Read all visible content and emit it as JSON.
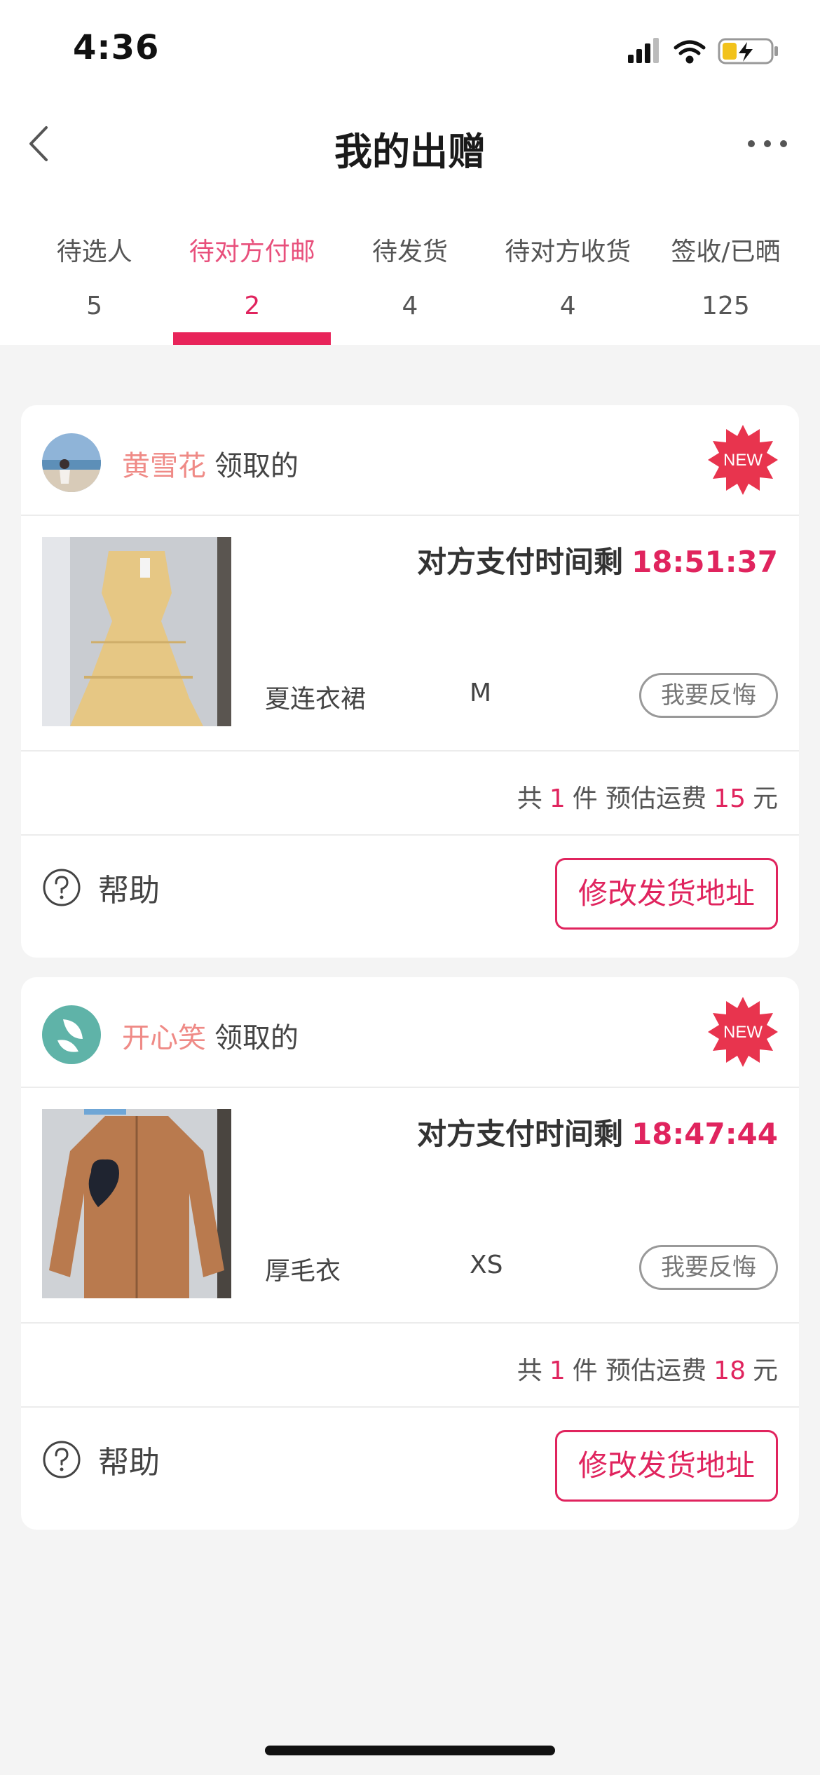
{
  "status_bar": {
    "time": "4:36"
  },
  "nav": {
    "title": "我的出赠"
  },
  "tabs": [
    {
      "label": "待选人",
      "count": "5",
      "active": false
    },
    {
      "label": "待对方付邮",
      "count": "2",
      "active": true
    },
    {
      "label": "待发货",
      "count": "4",
      "active": false
    },
    {
      "label": "待对方收货",
      "count": "4",
      "active": false
    },
    {
      "label": "签收/已晒",
      "count": "125",
      "active": false
    }
  ],
  "cards": [
    {
      "claimer_name": "黄雪花",
      "claimer_suffix": "领取的",
      "badge": "NEW",
      "countdown_label": "对方支付时间剩",
      "countdown": "18:51:37",
      "item_name": "夏连衣裙",
      "item_size": "M",
      "regret_label": "我要反悔",
      "summary_prefix": "共",
      "count": "1",
      "summary_mid": "件 预估运费",
      "shipping": "15",
      "summary_suffix": "元",
      "help_label": "帮助",
      "address_button": "修改发货地址"
    },
    {
      "claimer_name": "开心笑",
      "claimer_suffix": "领取的",
      "badge": "NEW",
      "countdown_label": "对方支付时间剩",
      "countdown": "18:47:44",
      "item_name": "厚毛衣",
      "item_size": "XS",
      "regret_label": "我要反悔",
      "summary_prefix": "共",
      "count": "1",
      "summary_mid": "件 预估运费",
      "shipping": "18",
      "summary_suffix": "元",
      "help_label": "帮助",
      "address_button": "修改发货地址"
    }
  ],
  "colors": {
    "accent": "#e0245e",
    "claimer_name": "#ef8a86",
    "badge": "#e8344e"
  }
}
